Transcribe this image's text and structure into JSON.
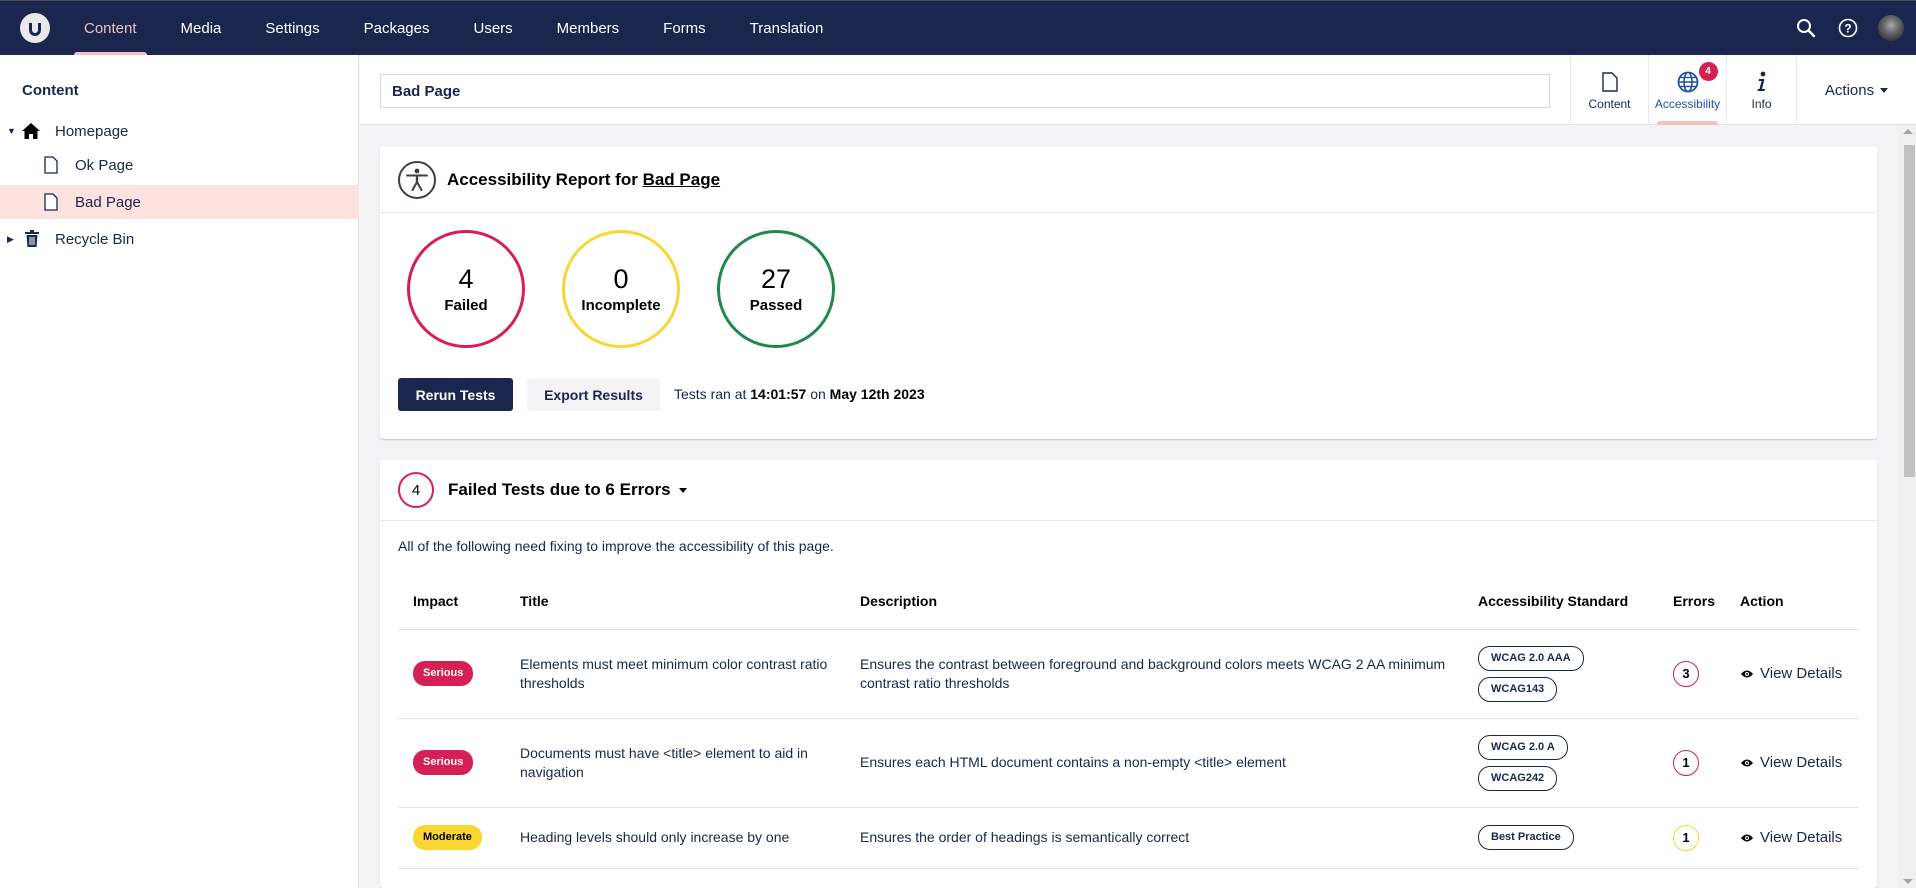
{
  "topnav": {
    "items": [
      {
        "label": "Content",
        "active": true
      },
      {
        "label": "Media",
        "active": false
      },
      {
        "label": "Settings",
        "active": false
      },
      {
        "label": "Packages",
        "active": false
      },
      {
        "label": "Users",
        "active": false
      },
      {
        "label": "Members",
        "active": false
      },
      {
        "label": "Forms",
        "active": false
      },
      {
        "label": "Translation",
        "active": false
      }
    ],
    "right_icons": [
      "search-icon",
      "help-icon",
      "user-avatar"
    ]
  },
  "sidebar": {
    "title": "Content",
    "tree": [
      {
        "label": "Homepage",
        "icon": "home-icon",
        "expanded": true
      },
      {
        "label": "Ok Page",
        "icon": "document-icon"
      },
      {
        "label": "Bad Page",
        "icon": "document-icon",
        "selected": true
      },
      {
        "label": "Recycle Bin",
        "icon": "trash-icon",
        "expanded": false
      }
    ]
  },
  "editor": {
    "name_value": "Bad Page",
    "apps": [
      {
        "label": "Content",
        "icon": "document-icon"
      },
      {
        "label": "Accessibility",
        "icon": "globe-icon",
        "badge": "4",
        "active": true
      },
      {
        "label": "Info",
        "icon": "info-icon"
      }
    ],
    "actions_label": "Actions"
  },
  "report": {
    "title_prefix": "Accessibility Report for",
    "page_link": "Bad Page",
    "stats": [
      {
        "value": "4",
        "label": "Failed",
        "color": "#d42054"
      },
      {
        "value": "0",
        "label": "Incomplete",
        "color": "#fad634"
      },
      {
        "value": "27",
        "label": "Passed",
        "color": "#1e8a4a"
      }
    ],
    "rerun_label": "Rerun Tests",
    "export_label": "Export Results",
    "ran_prefix": "Tests ran at",
    "ran_time": "14:01:57",
    "ran_on": "on",
    "ran_date": "May 12th 2023"
  },
  "failed": {
    "count": "4",
    "title": "Failed Tests due to 6 Errors",
    "intro": "All of the following need fixing to improve the accessibility of this page.",
    "columns": [
      "Impact",
      "Title",
      "Description",
      "Accessibility Standard",
      "Errors",
      "Action"
    ],
    "rows": [
      {
        "impact": "Serious",
        "title": "Elements must meet minimum color contrast ratio thresholds",
        "description": "Ensures the contrast between foreground and background colors meets WCAG 2 AA minimum contrast ratio thresholds",
        "standards": [
          "WCAG 2.0 AAA",
          "WCAG143"
        ],
        "errors": "3",
        "action": "View Details"
      },
      {
        "impact": "Serious",
        "title": "Documents must have <title> element to aid in navigation",
        "description": "Ensures each HTML document contains a non-empty <title> element",
        "standards": [
          "WCAG 2.0 A",
          "WCAG242"
        ],
        "errors": "1",
        "action": "View Details"
      },
      {
        "impact": "Moderate",
        "title": "Heading levels should only increase by one",
        "description": "Ensures the order of headings is semantically correct",
        "standards": [
          "Best Practice"
        ],
        "errors": "1",
        "action": "View Details"
      }
    ]
  },
  "colors": {
    "brand_navy": "#1b264f",
    "accent_pink": "#f5c1bc",
    "serious": "#d42054",
    "moderate": "#fad634",
    "passed": "#1e8a4a"
  }
}
